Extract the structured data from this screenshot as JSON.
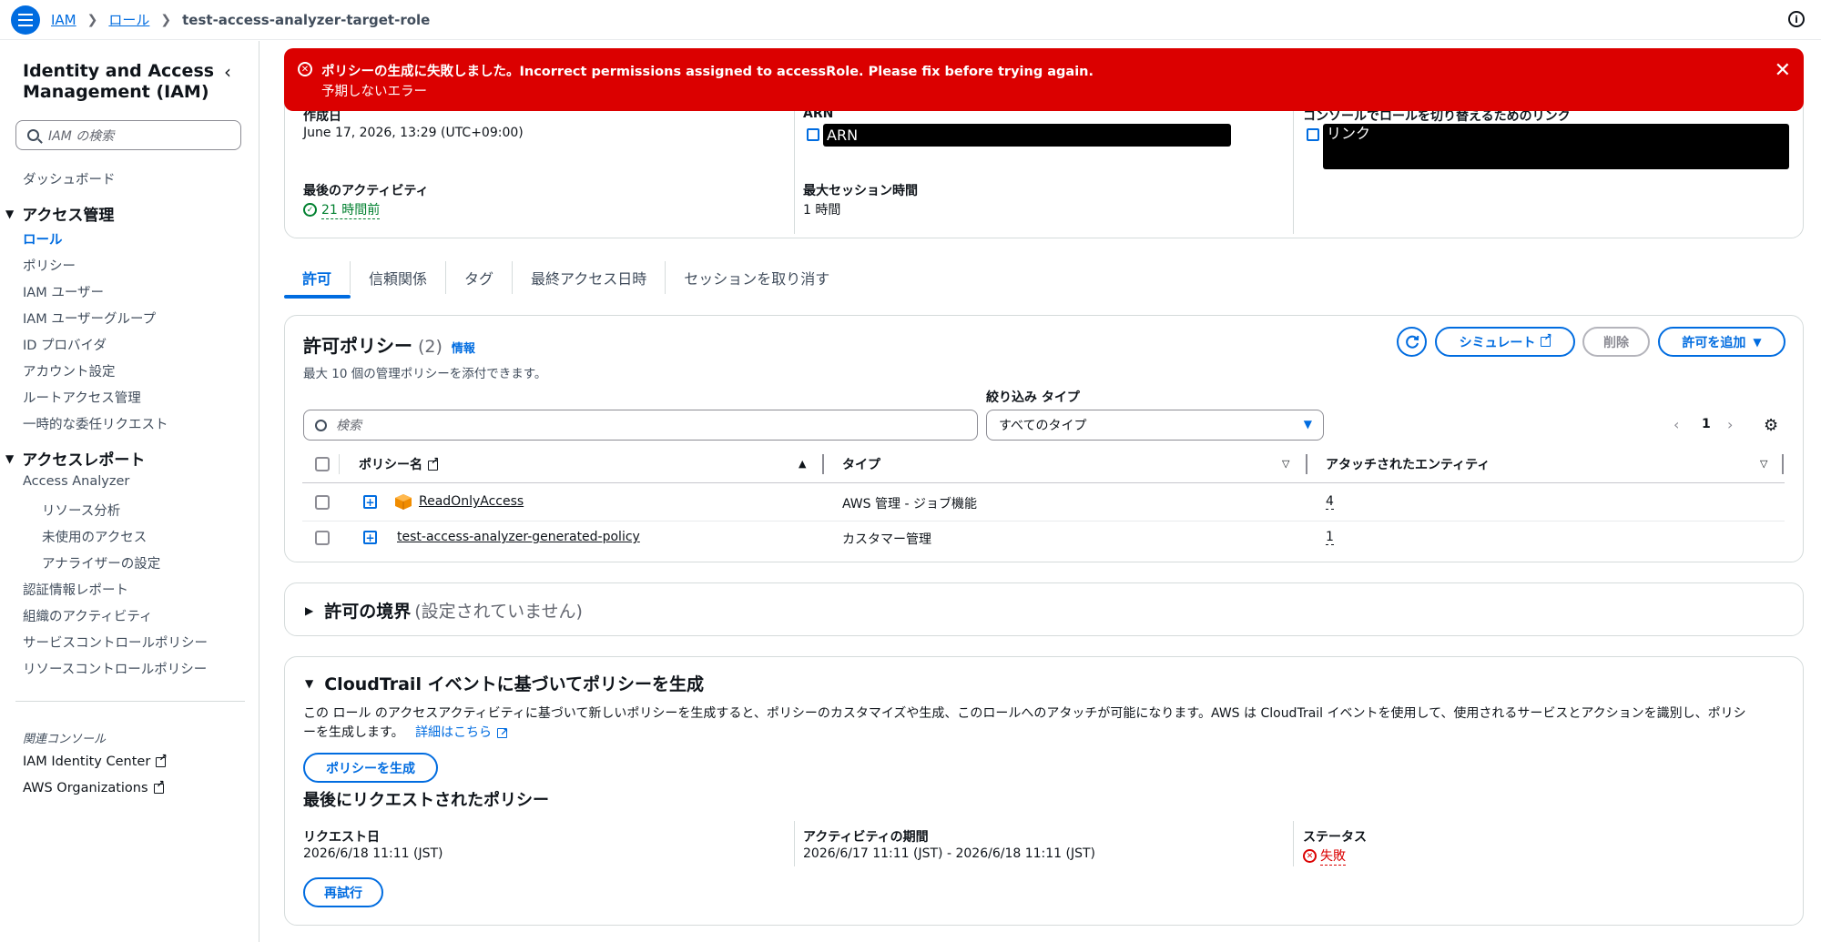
{
  "breadcrumb": {
    "service": "IAM",
    "section": "ロール",
    "current": "test-access-analyzer-target-role"
  },
  "sidebar": {
    "title": "Identity and Access Management (IAM)",
    "search_placeholder": "IAM の検索",
    "dashboard": "ダッシュボード",
    "access_mgmt": "アクセス管理",
    "access_items": [
      "ロール",
      "ポリシー",
      "IAM ユーザー",
      "IAM ユーザーグループ",
      "ID プロバイダ",
      "アカウント設定",
      "ルートアクセス管理",
      "一時的な委任リクエスト"
    ],
    "access_reports": "アクセスレポート",
    "analyzer": "Access Analyzer",
    "analyzer_items": [
      "リソース分析",
      "未使用のアクセス",
      "アナライザーの設定"
    ],
    "report_items": [
      "認証情報レポート",
      "組織のアクティビティ",
      "サービスコントロールポリシー",
      "リソースコントロールポリシー"
    ],
    "related": "関連コンソール",
    "related_items": [
      "IAM Identity Center",
      "AWS Organizations"
    ]
  },
  "alert": {
    "message": "ポリシーの生成に失敗しました。Incorrect permissions assigned to accessRole. Please fix before trying again.",
    "sub": "予期しないエラー",
    "color": "#db0000"
  },
  "summary": {
    "created_label": "作成日",
    "created_value": "June 17, 2026, 13:29 (UTC+09:00)",
    "arn_label": "ARN",
    "arn_value": "ARN",
    "switch_label": "コンソールでロールを切り替えるためのリンク",
    "switch_value": "リンク",
    "last_activity_label": "最後のアクティビティ",
    "last_activity_value": "21 時間前",
    "max_session_label": "最大セッション時間",
    "max_session_value": "1 時間"
  },
  "tabs": [
    "許可",
    "信頼関係",
    "タグ",
    "最終アクセス日時",
    "セッションを取り消す"
  ],
  "permissions": {
    "title": "許可ポリシー",
    "count": "(2)",
    "info": "情報",
    "description": "最大 10 個の管理ポリシーを添付できます。",
    "simulate": "シミュレート",
    "delete": "削除",
    "add": "許可を追加",
    "search_placeholder": "検索",
    "filter_label": "絞り込み タイプ",
    "filter_value": "すべてのタイプ",
    "page": "1",
    "columns": [
      "ポリシー名",
      "タイプ",
      "アタッチされたエンティティ"
    ],
    "rows": [
      {
        "name": "ReadOnlyAccess",
        "type": "AWS 管理 - ジョブ機能",
        "entities": "4"
      },
      {
        "name": "test-access-analyzer-generated-policy",
        "type": "カスタマー管理",
        "entities": "1"
      }
    ]
  },
  "boundary": {
    "title": "許可の境界",
    "status": "(設定されていません)"
  },
  "cloudtrail": {
    "title": "CloudTrail イベントに基づいてポリシーを生成",
    "desc1": "この ロール のアクセスアクティビティに基づいて新しいポリシーを生成すると、ポリシーのカスタマイズや生成、このロールへのアタッチが可能になります。AWS は CloudTrail イベントを使用して、使用されるサービスとアクションを識別し、ポリシ",
    "desc2": "ーを生成します。",
    "learn_more": "詳細はこちら",
    "generate": "ポリシーを生成",
    "last_title": "最後にリクエストされたポリシー",
    "req_date_label": "リクエスト日",
    "req_date_value": "2026/6/18 11:11 (JST)",
    "period_label": "アクティビティの期間",
    "period_value": "2026/6/17 11:11 (JST) - 2026/6/18 11:11 (JST)",
    "status_label": "ステータス",
    "status_value": "失敗",
    "retry": "再試行"
  },
  "colors": {
    "accent": "#006ce0",
    "error": "#db0000",
    "success": "#00802f"
  }
}
